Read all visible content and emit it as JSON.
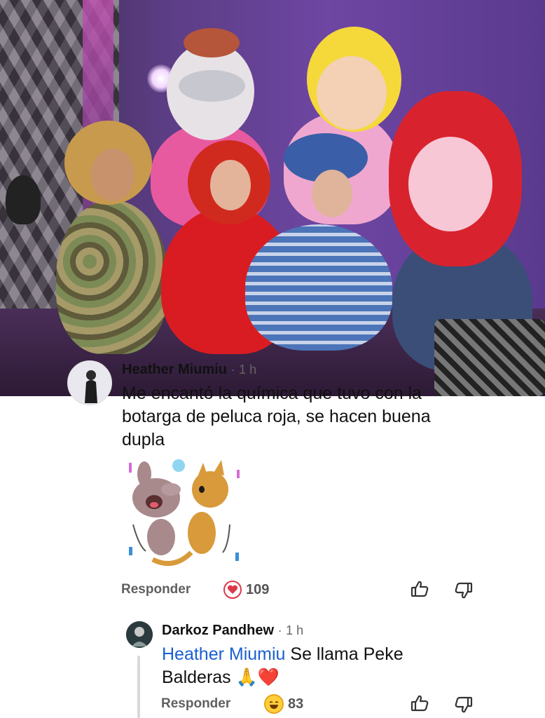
{
  "post_photo": {
    "alt_icon": "group-photo"
  },
  "comment": {
    "author": "Heather Miumiu",
    "separator": "·",
    "time": "1 h",
    "text": "Me encantó la química que tuvo con la botarga de peluca roja, se hacen buena dupla",
    "sticker_icon": "dancing-pets-sticker",
    "reply_label": "Responder",
    "reaction_icon": "heart-icon",
    "reaction_count": "109"
  },
  "reply": {
    "author": "Darkoz Pandhew",
    "separator": "·",
    "time": "1 h",
    "mention": "Heather Miumiu",
    "text": " Se llama Peke Balderas 🙏❤️",
    "reply_label": "Responder",
    "reaction_icon": "laugh-emoji-icon",
    "reaction_count": "83"
  },
  "colors": {
    "mention": "#1a5fd0",
    "heart": "#e0364a",
    "meta_text": "#606060"
  }
}
